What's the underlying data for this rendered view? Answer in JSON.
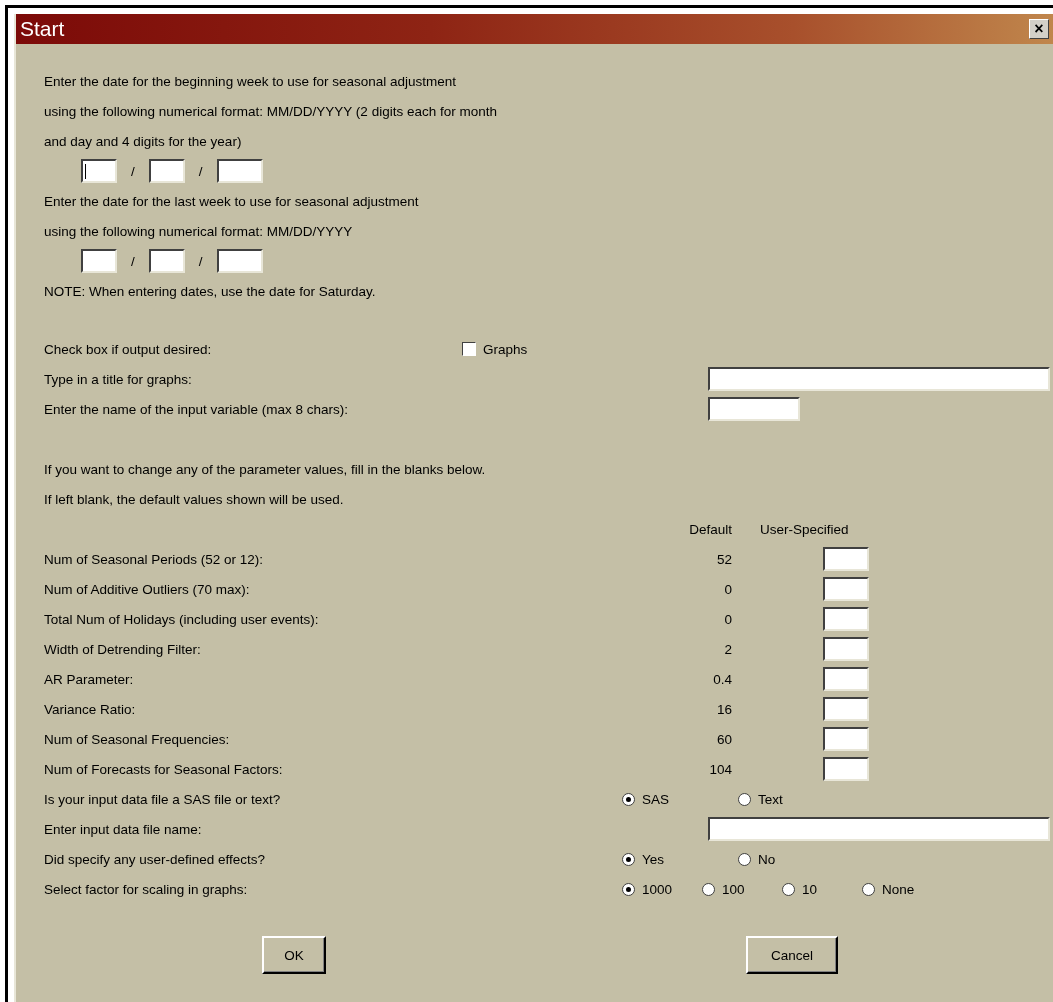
{
  "window": {
    "title": "Start",
    "close": "×"
  },
  "date_sections": [
    {
      "lines": [
        "Enter the date for the beginning week to use for seasonal adjustment",
        "using the following numerical format: MM/DD/YYYY (2 digits each for month",
        "and day and 4 digits for the year)"
      ],
      "separators": [
        "/",
        "/"
      ],
      "fields": [
        {
          "focused": true
        },
        {
          "focused": false
        },
        {
          "focused": false
        }
      ]
    },
    {
      "lines": [
        "Enter the date for the last week to use for seasonal adjustment",
        "using the following numerical format: MM/DD/YYYY"
      ],
      "separators": [
        "/",
        "/"
      ],
      "fields": [
        {
          "focused": false
        },
        {
          "focused": false
        },
        {
          "focused": false
        }
      ]
    }
  ],
  "note": "NOTE: When entering dates, use the date for Saturday.",
  "output_rows": [
    {
      "kind": "checkbox",
      "label": "Check box if output desired:",
      "option": {
        "label": "Graphs",
        "checked": false
      }
    },
    {
      "kind": "longfield",
      "label": "Type in a title for graphs:"
    },
    {
      "kind": "shortfield",
      "label": "Enter the name of the input variable (max 8 chars):"
    }
  ],
  "instructions": [
    "If you want to change any of the parameter values, fill in the blanks below.",
    "If left blank, the default values shown will be used."
  ],
  "columns": {
    "default": "Default",
    "user": "User-Specified"
  },
  "parameters": [
    {
      "label": "Num of Seasonal Periods (52 or 12):",
      "default": "52"
    },
    {
      "label": "Num of Additive Outliers (70 max):",
      "default": "0"
    },
    {
      "label": "Total Num of Holidays (including user events):",
      "default": "0"
    },
    {
      "label": "Width of Detrending Filter:",
      "default": "2"
    },
    {
      "label": "AR Parameter:",
      "default": "0.4"
    },
    {
      "label": "Variance Ratio:",
      "default": "16"
    },
    {
      "label": "Num of Seasonal Frequencies:",
      "default": "60"
    },
    {
      "label": "Num of Forecasts for Seasonal Factors:",
      "default": "104"
    }
  ],
  "option_rows": [
    {
      "kind": "radio",
      "label": "Is your input data file a SAS file or text?",
      "options": [
        {
          "label": "SAS",
          "selected": true
        },
        {
          "label": "Text",
          "selected": false
        }
      ]
    },
    {
      "kind": "longfield",
      "label": "Enter input data file name:"
    },
    {
      "kind": "radio",
      "label": "Did specify any user-defined effects?",
      "options": [
        {
          "label": "Yes",
          "selected": true
        },
        {
          "label": "No",
          "selected": false
        }
      ]
    },
    {
      "kind": "radio",
      "label": "Select factor for scaling in graphs:",
      "options": [
        {
          "label": "1000",
          "selected": true
        },
        {
          "label": "100",
          "selected": false
        },
        {
          "label": "10",
          "selected": false
        },
        {
          "label": "None",
          "selected": false
        }
      ]
    }
  ],
  "buttons": [
    "OK",
    "Cancel"
  ]
}
